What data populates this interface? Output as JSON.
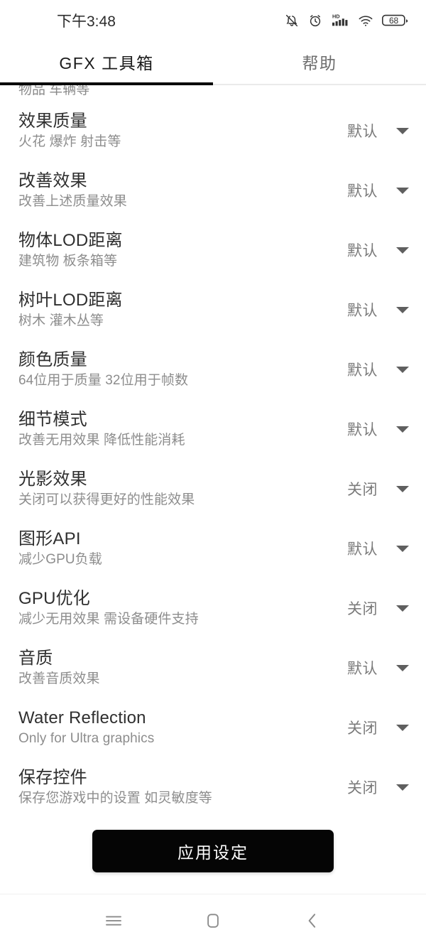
{
  "status_bar": {
    "time": "下午3:48",
    "icons": [
      {
        "name": "bell-muted-icon"
      },
      {
        "name": "alarm-clock-icon"
      },
      {
        "name": "hd-signal-icon",
        "label": "HD"
      },
      {
        "name": "wifi-icon"
      },
      {
        "name": "battery-icon",
        "level": "68"
      }
    ]
  },
  "header": {
    "tabs": [
      {
        "label": "GFX 工具箱",
        "active": true
      },
      {
        "label": "帮助",
        "active": false
      }
    ]
  },
  "clipped_top_row": {
    "subtitle": "物品 车辆等"
  },
  "settings": [
    {
      "title": "效果质量",
      "subtitle": "火花 爆炸 射击等",
      "value": "默认"
    },
    {
      "title": "改善效果",
      "subtitle": "改善上述质量效果",
      "value": "默认"
    },
    {
      "title": "物体LOD距离",
      "subtitle": "建筑物 板条箱等",
      "value": "默认"
    },
    {
      "title": "树叶LOD距离",
      "subtitle": "树木 灌木丛等",
      "value": "默认"
    },
    {
      "title": "颜色质量",
      "subtitle": "64位用于质量 32位用于帧数",
      "value": "默认"
    },
    {
      "title": "细节模式",
      "subtitle": "改善无用效果 降低性能消耗",
      "value": "默认"
    },
    {
      "title": "光影效果",
      "subtitle": "关闭可以获得更好的性能效果",
      "value": "关闭"
    },
    {
      "title": "图形API",
      "subtitle": "减少GPU负载",
      "value": "默认"
    },
    {
      "title": "GPU优化",
      "subtitle": "减少无用效果 需设备硬件支持",
      "value": "关闭"
    },
    {
      "title": "音质",
      "subtitle": "改善音质效果",
      "value": "默认"
    },
    {
      "title": "Water Reflection",
      "subtitle": "Only for Ultra graphics",
      "value": "关闭"
    },
    {
      "title": "保存控件",
      "subtitle": "保存您游戏中的设置 如灵敏度等",
      "value": "关闭"
    }
  ],
  "apply_button": {
    "label": "应用设定"
  },
  "nav_bar": {
    "buttons": [
      {
        "name": "menu-icon"
      },
      {
        "name": "home-icon"
      },
      {
        "name": "back-icon"
      }
    ]
  },
  "colors": {
    "accent": "#000000",
    "title_text": "#2f2f2f",
    "subtitle_text": "#8d8d8d",
    "value_text": "#7b7b7b",
    "background": "#ffffff"
  }
}
